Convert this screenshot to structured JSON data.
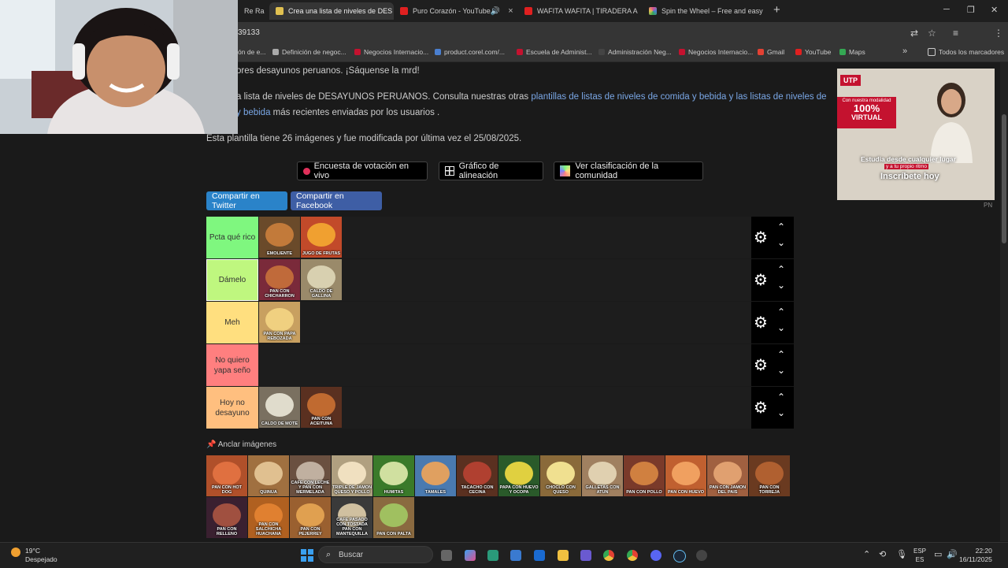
{
  "tabs": [
    {
      "label": "Re Ra",
      "x": "×",
      "color": "#888"
    },
    {
      "label": "Crea una lista de niveles de DES",
      "x": "×",
      "color": "#e0c050",
      "active": true
    },
    {
      "label": "Puro Corazón - YouTube",
      "x": "×",
      "color": "#e02020"
    },
    {
      "label": "WAFITA WAFITA | TIRADERA A",
      "x": "×",
      "color": "#e02020"
    },
    {
      "label": "Spin the Wheel – Free and easy",
      "x": "×",
      "color": "#e0508a"
    }
  ],
  "new_tab": "+",
  "window": {
    "min": "─",
    "max": "❐",
    "close": "✕"
  },
  "address": {
    "url": "39133"
  },
  "bookmarks": [
    {
      "label": "ón de e...",
      "color": "#888"
    },
    {
      "label": "Definición de negoc...",
      "color": "#aaa"
    },
    {
      "label": "Negocios Internacio...",
      "color": "#c4122f"
    },
    {
      "label": "product.corel.com/...",
      "color": "#4a7fd0"
    },
    {
      "label": "Escuela de Administ...",
      "color": "#c4122f"
    },
    {
      "label": "Administración Neg...",
      "color": "#444"
    },
    {
      "label": "Negocios Internacio...",
      "color": "#c4122f"
    },
    {
      "label": "Gmail",
      "color": "#e34133"
    },
    {
      "label": "YouTube",
      "color": "#e02020"
    },
    {
      "label": "Maps",
      "color": "#34a853"
    }
  ],
  "bookmarks_more": "»",
  "all_bookmarks": "Todos los marcadores",
  "page": {
    "line1": "ores desayunos peruanos. ¡Sáquense la mrd!",
    "line2_a": "a lista de niveles de DESAYUNOS PERUANOS. Consulta nuestras otras ",
    "line2_link": "plantillas de listas de niveles de comida y bebida y las listas de niveles de",
    "line3_link": "y bebida",
    "line3_b": " más recientes enviadas por los usuarios .",
    "template_info": "Esta plantilla tiene 26 imágenes y fue modificada por última vez el 25/08/2025.",
    "btn_poll": "Encuesta de votación en vivo",
    "btn_align": "Gráfico de alineación",
    "btn_community": "Ver clasificación de la comunidad",
    "share_twitter": "Compartir en Twitter",
    "share_facebook": "Compartir en Facebook",
    "pin_images": "Anclar imágenes"
  },
  "tiers": [
    {
      "label": "Pcta qué rico",
      "color": "#7ff77f",
      "items": [
        {
          "caption": "EMOLIENTE",
          "bg": "#6a4a2a",
          "fg": "#c27a3a"
        },
        {
          "caption": "JUGO DE FRUTAS",
          "bg": "#c24a2a",
          "fg": "#f0a030"
        }
      ]
    },
    {
      "label": "Dámelo",
      "color": "#bff77f",
      "items": [
        {
          "caption": "PAN CON CHICHARRON",
          "bg": "#7a2a3a",
          "fg": "#c06a3a"
        },
        {
          "caption": "CALDO DE GALLINA",
          "bg": "#9a8a6a",
          "fg": "#d8d0b0"
        }
      ]
    },
    {
      "label": "Meh",
      "color": "#ffdf7f",
      "items": [
        {
          "caption": "PAN CON PAPA REBOZADA",
          "bg": "#c8a060",
          "fg": "#f0d080"
        }
      ]
    },
    {
      "label": "No quiero yapa seño",
      "color": "#ff7f7f",
      "items": []
    },
    {
      "label": "Hoy no desayuno",
      "color": "#ffbf7f",
      "items": [
        {
          "caption": "CALDO DE MOTE",
          "bg": "#7a7060",
          "fg": "#e0dccc"
        },
        {
          "caption": "PAN CON ACEITUNA",
          "bg": "#5a3020",
          "fg": "#c06a30"
        }
      ]
    }
  ],
  "tier_controls": {
    "gear": "⚙",
    "up": "⌃",
    "down": "⌄"
  },
  "pool": [
    {
      "caption": "PAN CON HOT DOG",
      "bg": "#b0502a",
      "fg": "#e07040"
    },
    {
      "caption": "QUINUA",
      "bg": "#a07040",
      "fg": "#e0c090"
    },
    {
      "caption": "CAFE CON LECHE Y PAN CON MERMELADA",
      "bg": "#6a5040",
      "fg": "#c0b0a0"
    },
    {
      "caption": "TRIPLE DE JAMON QUESO Y POLLO",
      "bg": "#b0a080",
      "fg": "#f0e0c0"
    },
    {
      "caption": "HUMITAS",
      "bg": "#3a7a2a",
      "fg": "#d0e0a0"
    },
    {
      "caption": "TAMALES",
      "bg": "#4a7ab0",
      "fg": "#e0a060"
    },
    {
      "caption": "TACACHO CON CECINA",
      "bg": "#5a3020",
      "fg": "#b04030"
    },
    {
      "caption": "PAPA CON HUEVO Y OCOPA",
      "bg": "#2a5a2a",
      "fg": "#e0d040"
    },
    {
      "caption": "CHOCLO CON QUESO",
      "bg": "#8a6a3a",
      "fg": "#f0e090"
    },
    {
      "caption": "GALLETAS CON ATUN",
      "bg": "#a08060",
      "fg": "#e0d0b0"
    },
    {
      "caption": "PAN CON POLLO",
      "bg": "#7a3a2a",
      "fg": "#d08040"
    },
    {
      "caption": "PAN CON HUEVO",
      "bg": "#c06030",
      "fg": "#f0a060"
    },
    {
      "caption": "PAN CON JAMON DEL PAIS",
      "bg": "#a06040",
      "fg": "#e0a070"
    },
    {
      "caption": "PAN CON TORREJA",
      "bg": "#6a3a20",
      "fg": "#b06030"
    },
    {
      "caption": "PAN CON RELLENO",
      "bg": "#3a2030",
      "fg": "#a05040"
    },
    {
      "caption": "PAN CON SALCHICHA HUACHANA",
      "bg": "#b06020",
      "fg": "#e08030"
    },
    {
      "caption": "PAN CON PEJERREY",
      "bg": "#9a6030",
      "fg": "#e0a050"
    },
    {
      "caption": "CAFE PASADO CON TOSTADA PAN CON MANTEQUILLA",
      "bg": "#3a3a3a",
      "fg": "#d0c0a0"
    },
    {
      "caption": "PAN CON PALTA",
      "bg": "#8a6a40",
      "fg": "#a0c060"
    }
  ],
  "ad": {
    "logo": "UTP",
    "modality": "Con nuestra modalidad",
    "percent": "100%",
    "virtual": "VIRTUAL",
    "line1": "Estudia desde cualquier lugar",
    "line2": "y a tu propio ritmo",
    "cta": "Inscríbete hoy",
    "pn": "PN"
  },
  "taskbar": {
    "temp": "19°C",
    "weather": "Despejado",
    "search": "Buscar",
    "lang1": "ESP",
    "lang2": "ES",
    "time": "22:20",
    "date": "16/11/2025"
  }
}
